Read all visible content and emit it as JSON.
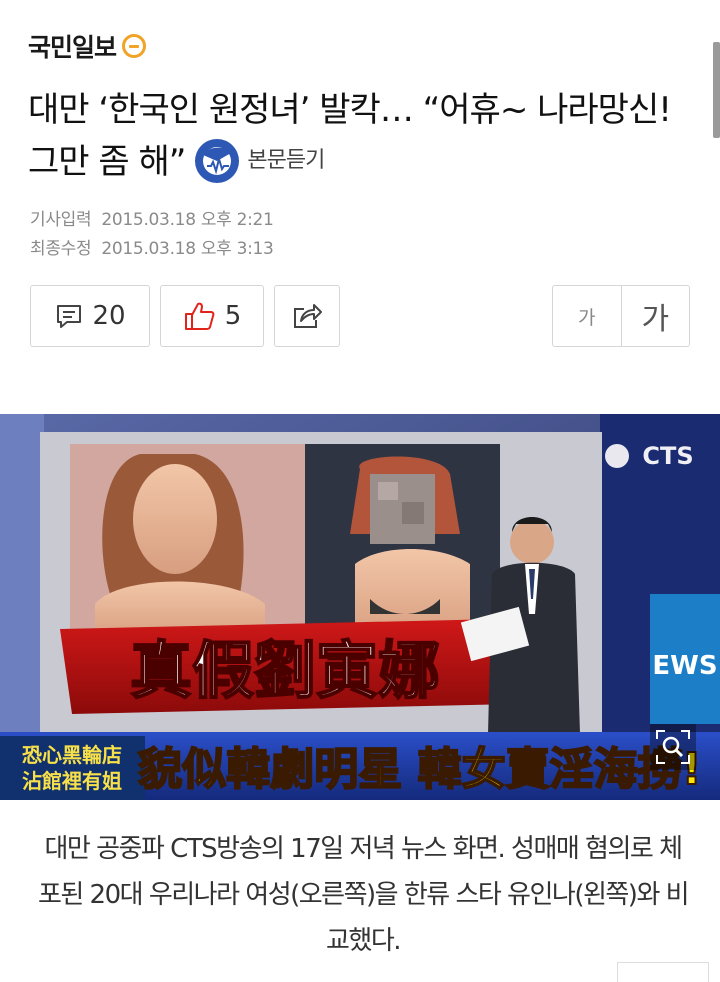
{
  "brand": {
    "name": "국민일보",
    "logo_icon": "kukmin-circle-logo",
    "logo_color": "#f0a326"
  },
  "article": {
    "headline": "대만 ‘한국인 원정녀’ 발칵… “어휴~ 나라망신! 그만 좀 해”",
    "listen_label": "본문듣기",
    "listen_icon": "face-soundwave-icon",
    "meta": {
      "published_label": "기사입력",
      "published_value": "2015.03.18 오후 2:21",
      "modified_label": "최종수정",
      "modified_value": "2015.03.18 오후 3:13"
    },
    "actions": {
      "comment_icon": "comment-icon",
      "comment_count": "20",
      "like_icon": "thumbs-up-icon",
      "like_count": "5",
      "share_icon": "share-icon",
      "font_small": "가",
      "font_large": "가"
    },
    "photo": {
      "channel_logo": "CTS",
      "graphic_title": "真假劉寅娜",
      "ticker_left_line1": "恐心黑輪店",
      "ticker_left_line2": "沾館裡有姐",
      "ticker_main": "貌似韓劇明星 韓女賣淫海撈!",
      "side_text": "EWS",
      "zoom_icon": "magnifier-zoom-icon"
    },
    "caption": "대만 공중파 CTS방송의 17일 저녁 뉴스 화면. 성매매 혐의로 체포된 20대 우리나라 여성(오른쪽)을 한류 스타 유인나(왼쪽)와 비교했다."
  },
  "colors": {
    "accent_blue": "#2d58b3",
    "like_red": "#e2231a"
  }
}
